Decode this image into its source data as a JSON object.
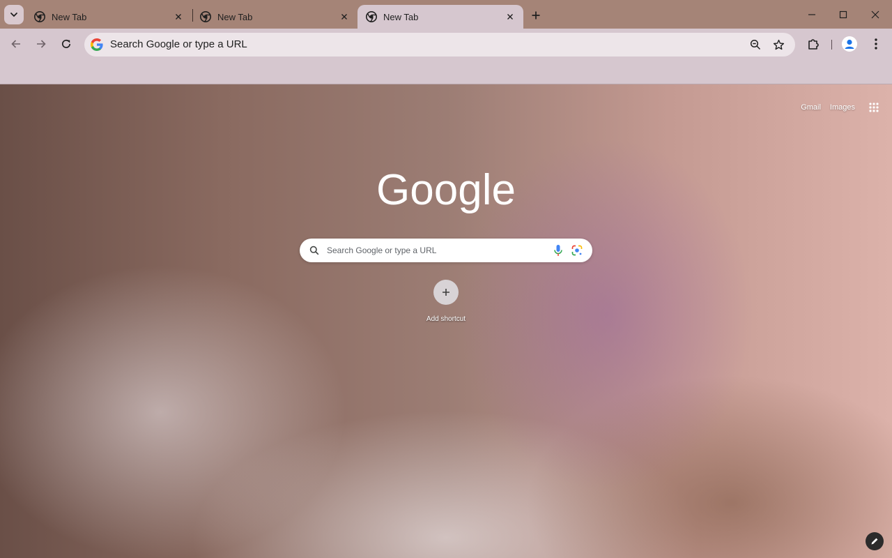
{
  "tabs": [
    {
      "title": "New Tab",
      "active": false
    },
    {
      "title": "New Tab",
      "active": false
    },
    {
      "title": "New Tab",
      "active": true
    }
  ],
  "icons": {
    "tab_search": "chevron-down-icon",
    "tab_favicon": "chrome-icon",
    "tab_close": "close-icon",
    "new_tab": "plus-icon",
    "minimize": "minimize-icon",
    "maximize": "maximize-icon",
    "close_window": "close-icon",
    "back": "arrow-left-icon",
    "forward": "arrow-right-icon",
    "reload": "reload-icon",
    "zoom": "zoom-icon",
    "bookmark": "star-icon",
    "extensions": "puzzle-icon",
    "profile": "avatar-icon",
    "menu": "kebab-menu-icon",
    "apps": "grid-icon",
    "search": "search-icon",
    "voice": "mic-icon",
    "lens": "lens-icon",
    "customize": "pencil-icon"
  },
  "omnibox": {
    "placeholder": "Search Google or type a URL"
  },
  "ntp": {
    "links": {
      "gmail": "Gmail",
      "images": "Images"
    },
    "logo_text": "Google",
    "search_placeholder": "Search Google or type a URL",
    "shortcut": {
      "label": "Add shortcut"
    }
  },
  "colors": {
    "frame": "#a58477",
    "toolbar": "#d6c7cf",
    "omnibox": "#ede5e9",
    "accent_blue": "#1a73e8"
  }
}
